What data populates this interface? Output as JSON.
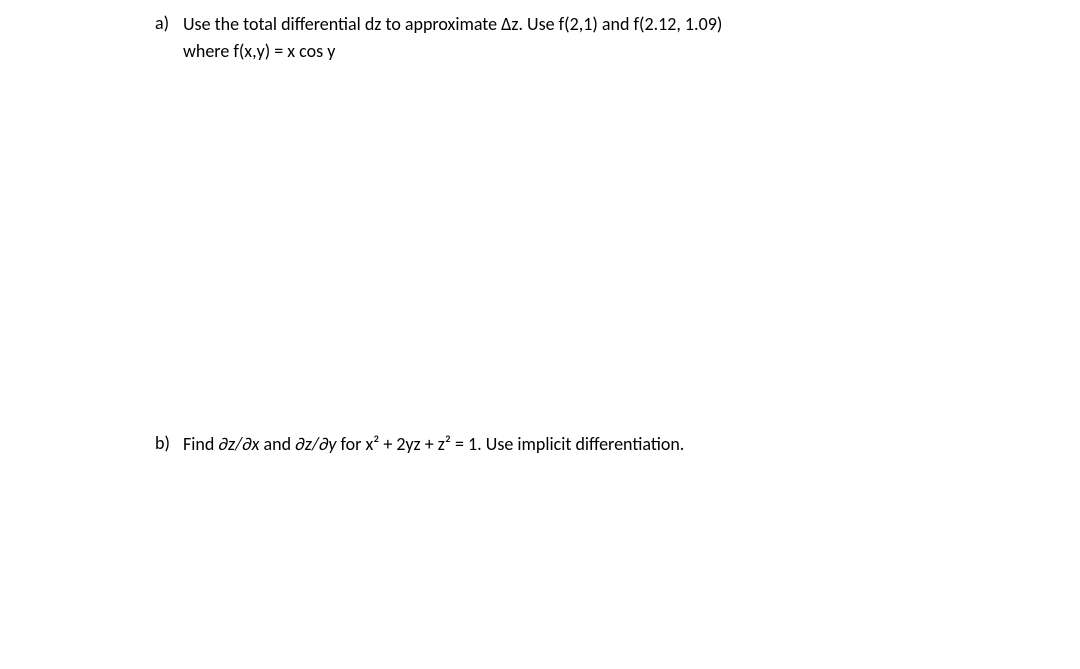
{
  "problems": {
    "a": {
      "label": "a)",
      "line1_part1": "Use the total differential dz to approximate Δz.   Use f(2,1)  and  f(2.12, 1.09)",
      "line2": "where f(x,y) =  x cos y"
    },
    "b": {
      "label": "b)",
      "text_part1": "Find  ",
      "expr1": "∂z/∂x",
      "text_part2": "   and ",
      "expr2": "∂z/∂y",
      "text_part3": "  for  x² + 2yz + z² = 1.   Use implicit differentiation."
    }
  }
}
